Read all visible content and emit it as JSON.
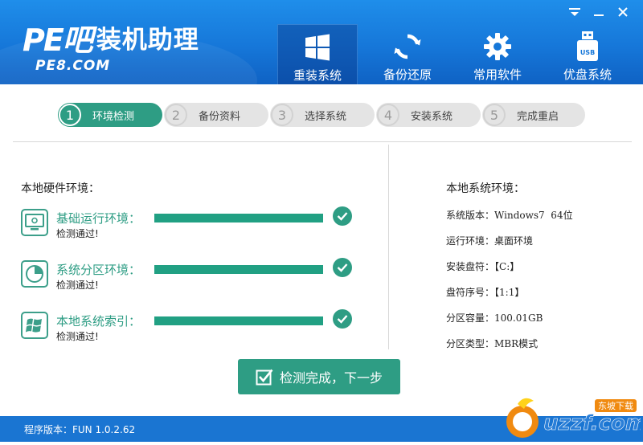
{
  "header": {
    "logo_mark": "PE吧",
    "app_title": "装机助理",
    "logo_sub": "PE8.COM"
  },
  "nav": [
    {
      "label": "重装系统",
      "icon": "windows-icon",
      "active": true
    },
    {
      "label": "备份还原",
      "icon": "refresh-icon",
      "active": false
    },
    {
      "label": "常用软件",
      "icon": "gear-icon",
      "active": false
    },
    {
      "label": "优盘系统",
      "icon": "usb-drive-icon",
      "active": false
    }
  ],
  "nav_usb_text": "USB",
  "steps": [
    {
      "num": "1",
      "label": "环境检测",
      "state": "done"
    },
    {
      "num": "2",
      "label": "备份资料",
      "state": "pending"
    },
    {
      "num": "3",
      "label": "选择系统",
      "state": "pending"
    },
    {
      "num": "4",
      "label": "安装系统",
      "state": "pending"
    },
    {
      "num": "5",
      "label": "完成重启",
      "state": "pending"
    }
  ],
  "hardware": {
    "title": "本地硬件环境：",
    "items": [
      {
        "label": "基础运行环境：",
        "status": "检测通过!",
        "icon": "monitor-icon",
        "progress": 1.0
      },
      {
        "label": "系统分区环境：",
        "status": "检测通过!",
        "icon": "pie-chart-icon",
        "progress": 1.0
      },
      {
        "label": "本地系统索引：",
        "status": "检测通过!",
        "icon": "windows-flag-icon",
        "progress": 1.0
      }
    ]
  },
  "system": {
    "title": "本地系统环境：",
    "rows": [
      {
        "label": "系统版本：",
        "value": "Windows7  64位"
      },
      {
        "label": "运行环境：",
        "value": "桌面环境"
      },
      {
        "label": "安装盘符：",
        "value": "【C:】"
      },
      {
        "label": "盘符序号：",
        "value": "【1:1】"
      },
      {
        "label": "分区容量：",
        "value": "100.01GB"
      },
      {
        "label": "分区类型：",
        "value": "MBR模式"
      }
    ]
  },
  "next_button": "检测完成，下一步",
  "footer": {
    "version": "程序版本：FUN 1.0.2.62"
  },
  "watermark": {
    "brand": "uzzf.com",
    "tag": "东坡下载"
  },
  "colors": {
    "header_blue": "#1677d9",
    "accent_green": "#2e9d84",
    "footer_blue": "#1a75d2",
    "pending_gray": "#e4e4e4"
  }
}
